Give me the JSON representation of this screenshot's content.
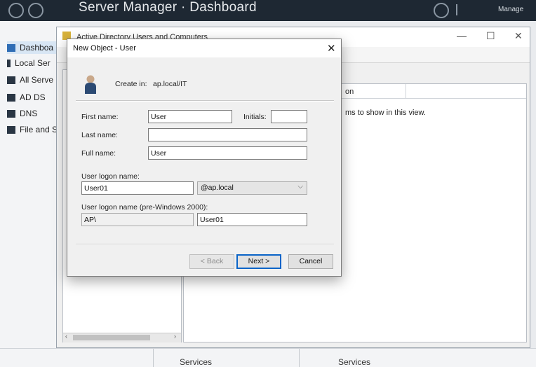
{
  "server_manager": {
    "title": "Server Manager · Dashboard",
    "manage_label": "Manage",
    "nav": [
      {
        "label": "Dashboa",
        "icon": "dashboard-grid-icon",
        "active": true
      },
      {
        "label": "Local Ser",
        "icon": "server-icon",
        "active": false
      },
      {
        "label": "All Serve",
        "icon": "servers-icon",
        "active": false
      },
      {
        "label": "AD DS",
        "icon": "ad-ds-icon",
        "active": false
      },
      {
        "label": "DNS",
        "icon": "dns-icon",
        "active": false
      },
      {
        "label": "File and S",
        "icon": "file-services-icon",
        "active": false
      }
    ],
    "services_labels": [
      "Services",
      "Services"
    ]
  },
  "aduc": {
    "title": "Active Directory Users and Computers",
    "column_header": "on",
    "empty_message": "ms to show in this view."
  },
  "dialog": {
    "title": "New Object - User",
    "create_in_label": "Create in:",
    "create_in_value": "ap.local/IT",
    "first_name_label": "First name:",
    "first_name_value": "User",
    "initials_label": "Initials:",
    "initials_value": "",
    "last_name_label": "Last name:",
    "last_name_value": "",
    "full_name_label": "Full name:",
    "full_name_value": "User",
    "logon_label": "User logon name:",
    "logon_value": "User01",
    "domain_value": "@ap.local",
    "pre2000_label": "User logon name (pre-Windows 2000):",
    "pre2000_domain": "AP\\",
    "pre2000_value": "User01",
    "back_label": "< Back",
    "next_label": "Next >",
    "cancel_label": "Cancel"
  }
}
